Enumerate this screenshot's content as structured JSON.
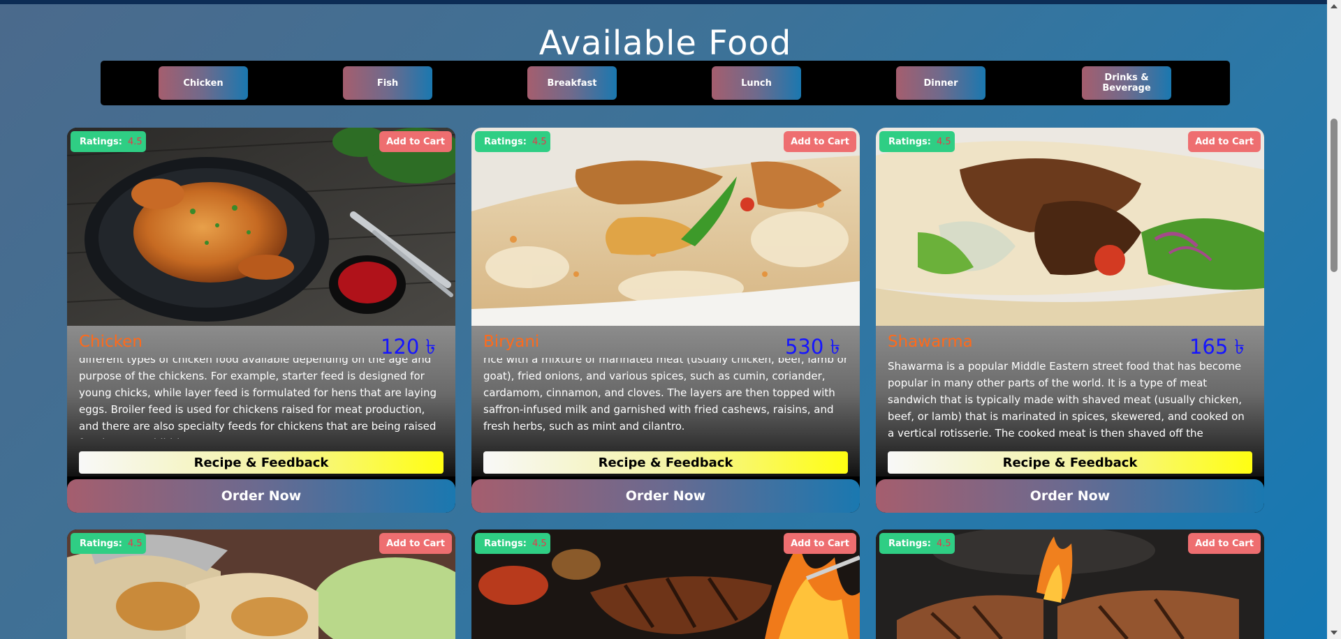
{
  "page": {
    "title": "Available Food"
  },
  "categories": [
    "Chicken",
    "Fish",
    "Breakfast",
    "Lunch",
    "Dinner",
    "Drinks & Beverage"
  ],
  "card_labels": {
    "ratings_label": "Ratings:",
    "add_to_cart": "Add to Cart",
    "recipe_feedback": "Recipe & Feedback",
    "order_now": "Order Now"
  },
  "foods": [
    {
      "name": "Chicken",
      "price": "120 ৳",
      "rating": "4.5",
      "description": "different types of chicken food available depending on the age and purpose of the chickens. For example, starter feed is designed for young chicks, while layer feed is formulated for hens that are laying eggs. Broiler feed is used for chickens raised for meat production, and there are also specialty feeds for chickens that are being raised for show or exhibition."
    },
    {
      "name": "Biryani",
      "price": "530 ৳",
      "rating": "4.5",
      "description": "rice with a mixture of marinated meat (usually chicken, beef, lamb or goat), fried onions, and various spices, such as cumin, coriander, cardamom, cinnamon, and cloves. The layers are then topped with saffron-infused milk and garnished with fried cashews, raisins, and fresh herbs, such as mint and cilantro."
    },
    {
      "name": "Shawarma",
      "price": "165 ৳",
      "rating": "4.5",
      "description": "Shawarma is a popular Middle Eastern street food that has become popular in many other parts of the world. It is a type of meat sandwich that is typically made with shaved meat (usually chicken, beef, or lamb) that is marinated in spices, skewered, and cooked on a vertical rotisserie. The cooked meat is then shaved off the rotisserie and served inside a pita"
    },
    {
      "rating": "4.5"
    },
    {
      "rating": "4.5"
    },
    {
      "rating": "4.5"
    }
  ]
}
